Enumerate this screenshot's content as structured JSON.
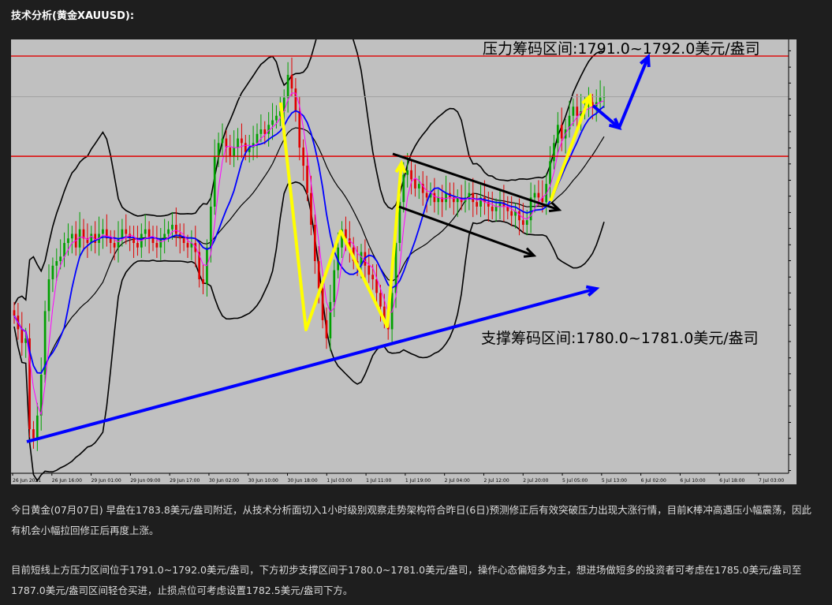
{
  "heading": "技术分析(黄金XAUUSD):",
  "chart_data": {
    "type": "candlestick",
    "colors": {
      "background": "#c0c0c0",
      "bull_candle": "#00a000",
      "bear_candle": "#e00000",
      "resistance_line": "#e00000",
      "bollinger": "#000000",
      "ma_blue": "#0000ff",
      "ma_magenta": "#ff00ff",
      "arrow_yellow": "#ffff00",
      "arrow_blue": "#0000ff",
      "arrow_black": "#000000"
    },
    "y_range": [
      1745.15,
      1792.9
    ],
    "y_ticks": [
      "1791.65",
      "1789.85",
      "1788.10",
      "1786.35",
      "1784.55",
      "1782.75",
      "1780.95",
      "1779.20",
      "1777.40",
      "1775.65",
      "1773.85",
      "1772.10",
      "1770.30",
      "1768.55",
      "1766.75",
      "1765.00",
      "1763.20",
      "1761.45",
      "1759.65",
      "1757.85",
      "1756.10",
      "1754.30",
      "1752.55",
      "1750.75",
      "1749.00",
      "1747.20",
      "1745.45"
    ],
    "x_ticks": [
      "26 Jun 2021",
      "26 Jun 16:00",
      "29 Jun 01:00",
      "29 Jun 09:00",
      "29 Jun 17:00",
      "30 Jun 02:00",
      "30 Jun 10:00",
      "30 Jun 18:00",
      "1 Jul 03:00",
      "1 Jul 11:00",
      "1 Jul 19:00",
      "2 Jul 04:00",
      "2 Jul 12:00",
      "2 Jul 20:00",
      "5 Jul 05:00",
      "5 Jul 13:00",
      "6 Jul 02:00",
      "6 Jul 10:00",
      "6 Jul 18:00",
      "7 Jul 03:00"
    ],
    "horizontal_lines": [
      {
        "label": "1791.07",
        "value": 1791.07
      },
      {
        "label": "1780.04",
        "value": 1780.04
      }
    ],
    "last_price": {
      "label": "1786.59",
      "value": 1786.59
    },
    "annotations": {
      "resistance": "压力筹码区间:1791.0~1792.0美元/盎司",
      "support": "支撑筹码区间:1780.0~1781.0美元/盎司"
    },
    "closes": [
      1762.5,
      1761.0,
      1759.5,
      1760.0,
      1750.0,
      1749.0,
      1751.5,
      1756.0,
      1763.0,
      1766.5,
      1768.0,
      1768.5,
      1769.0,
      1770.5,
      1771.0,
      1771.5,
      1770.0,
      1772.0,
      1771.0,
      1770.5,
      1771.5,
      1770.5,
      1771.5,
      1772.0,
      1771.0,
      1770.5,
      1770.0,
      1771.0,
      1772.0,
      1771.5,
      1771.0,
      1770.5,
      1770.0,
      1771.5,
      1772.0,
      1771.0,
      1770.5,
      1770.0,
      1771.0,
      1771.5,
      1772.0,
      1772.5,
      1771.5,
      1771.0,
      1770.5,
      1770.0,
      1770.5,
      1769.5,
      1766.5,
      1766.0,
      1770.0,
      1774.5,
      1780.0,
      1781.5,
      1782.0,
      1781.0,
      1780.0,
      1781.0,
      1782.0,
      1781.5,
      1780.5,
      1781.0,
      1781.5,
      1782.5,
      1783.0,
      1782.5,
      1783.5,
      1784.0,
      1784.5,
      1785.0,
      1786.5,
      1789.0,
      1787.5,
      1785.0,
      1781.0,
      1779.0,
      1776.0,
      1772.5,
      1768.5,
      1765.5,
      1762.0,
      1760.0,
      1764.0,
      1767.5,
      1770.0,
      1772.0,
      1771.0,
      1770.0,
      1768.5,
      1768.0,
      1769.5,
      1768.0,
      1767.0,
      1766.5,
      1765.0,
      1763.5,
      1762.0,
      1761.0,
      1765.0,
      1770.5,
      1775.0,
      1778.0,
      1778.5,
      1777.5,
      1776.5,
      1777.0,
      1776.0,
      1775.5,
      1776.0,
      1775.0,
      1775.5,
      1775.0,
      1776.0,
      1775.5,
      1775.0,
      1775.5,
      1775.0,
      1775.5,
      1776.0,
      1775.0,
      1774.5,
      1775.5,
      1775.0,
      1774.5,
      1774.0,
      1774.5,
      1775.0,
      1774.5,
      1774.0,
      1773.5,
      1774.0,
      1773.0,
      1772.5,
      1773.0,
      1775.5,
      1776.0,
      1775.5,
      1775.0,
      1777.0,
      1779.5,
      1781.5,
      1783.5,
      1782.0,
      1783.0,
      1784.5,
      1785.5,
      1784.5,
      1785.0,
      1785.5,
      1786.0,
      1785.5,
      1786.0,
      1786.5,
      1786.59
    ]
  },
  "paragraph1": "今日黄金(07月07日) 早盘在1783.8美元/盎司附近，从技术分析面切入1小时级别观察走势架构符合昨日(6日)预测修正后有效突破压力出现大涨行情，目前K棒冲高遇压小幅震荡，因此有机会小幅拉回修正后再度上涨。",
  "paragraph2": "目前短线上方压力区间位于1791.0~1792.0美元/盎司，下方初步支撑区间于1780.0~1781.0美元/盎司，操作心态偏短多为主，想进场做短多的投资者可考虑在1785.0美元/盎司至1787.0美元/盎司区间轻仓买进，止损点位可考虑设置1782.5美元/盎司下方。"
}
